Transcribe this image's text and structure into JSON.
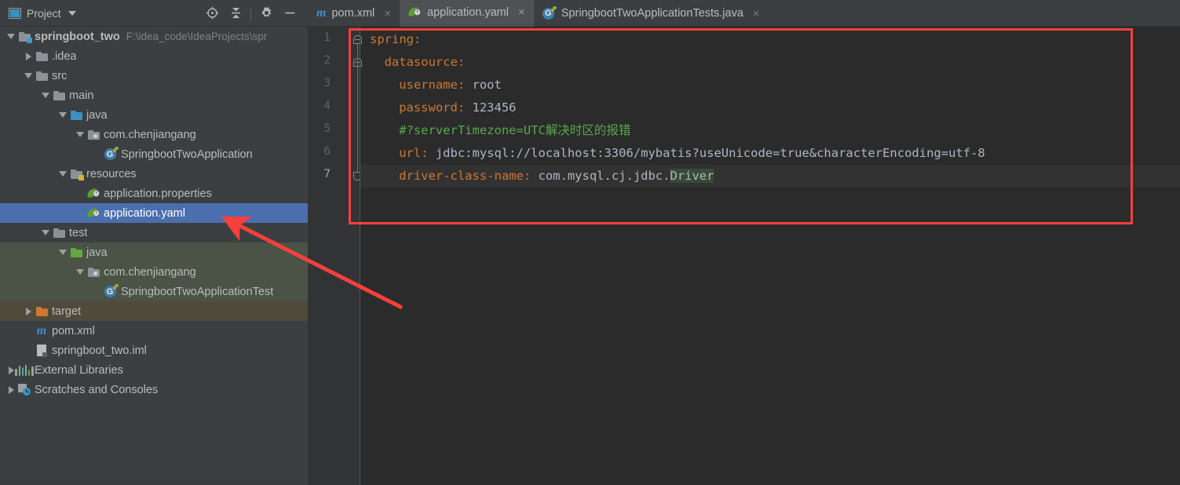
{
  "toolwindow": {
    "title": "Project",
    "icons": [
      {
        "name": "locate-target-icon",
        "glyph": "target"
      },
      {
        "name": "collapse-all-icon",
        "glyph": "collapse"
      },
      {
        "name": "settings-gear-icon",
        "glyph": "gear"
      },
      {
        "name": "hide-minimize-icon",
        "glyph": "minus"
      }
    ]
  },
  "tabs": [
    {
      "label": "pom.xml",
      "icon": "maven-icon",
      "active": false,
      "close": "×"
    },
    {
      "label": "application.yaml",
      "icon": "spring-leaf-icon",
      "active": true,
      "close": "×"
    },
    {
      "label": "SpringbootTwoApplicationTests.java",
      "icon": "spring-class-icon",
      "active": false,
      "close": "×"
    }
  ],
  "tree": [
    {
      "label": "springboot_two",
      "path": "F:\\idea_code\\IdeaProjects\\spr",
      "indent": 0,
      "twisty": "down",
      "icon": "module-folder",
      "bold": true,
      "state": "normal"
    },
    {
      "label": ".idea",
      "path": "",
      "indent": 1,
      "twisty": "right",
      "icon": "folder-gray",
      "bold": false,
      "state": "normal"
    },
    {
      "label": "src",
      "path": "",
      "indent": 1,
      "twisty": "down",
      "icon": "folder-gray",
      "bold": false,
      "state": "normal"
    },
    {
      "label": "main",
      "path": "",
      "indent": 2,
      "twisty": "down",
      "icon": "folder-gray",
      "bold": false,
      "state": "normal"
    },
    {
      "label": "java",
      "path": "",
      "indent": 3,
      "twisty": "down",
      "icon": "folder-blue",
      "bold": false,
      "state": "normal"
    },
    {
      "label": "com.chenjiangang",
      "path": "",
      "indent": 4,
      "twisty": "down",
      "icon": "package",
      "bold": false,
      "state": "normal"
    },
    {
      "label": "SpringbootTwoApplication",
      "path": "",
      "indent": 5,
      "twisty": "none",
      "icon": "spring-class-icon",
      "bold": false,
      "state": "normal"
    },
    {
      "label": "resources",
      "path": "",
      "indent": 3,
      "twisty": "down",
      "icon": "folder-resources",
      "bold": false,
      "state": "normal"
    },
    {
      "label": "application.properties",
      "path": "",
      "indent": 4,
      "twisty": "none",
      "icon": "spring-leaf-icon",
      "bold": false,
      "state": "normal"
    },
    {
      "label": "application.yaml",
      "path": "",
      "indent": 4,
      "twisty": "none",
      "icon": "spring-leaf-icon",
      "bold": false,
      "state": "selected"
    },
    {
      "label": "test",
      "path": "",
      "indent": 2,
      "twisty": "down",
      "icon": "folder-gray",
      "bold": false,
      "state": "normal"
    },
    {
      "label": "java",
      "path": "",
      "indent": 3,
      "twisty": "down",
      "icon": "folder-green",
      "bold": false,
      "state": "testroot"
    },
    {
      "label": "com.chenjiangang",
      "path": "",
      "indent": 4,
      "twisty": "down",
      "icon": "package",
      "bold": false,
      "state": "testroot"
    },
    {
      "label": "SpringbootTwoApplicationTest",
      "path": "",
      "indent": 5,
      "twisty": "none",
      "icon": "spring-class-icon",
      "bold": false,
      "state": "testroot"
    },
    {
      "label": "target",
      "path": "",
      "indent": 1,
      "twisty": "right",
      "icon": "folder-orange",
      "bold": false,
      "state": "excluded"
    },
    {
      "label": "pom.xml",
      "path": "",
      "indent": 1,
      "twisty": "none",
      "icon": "maven-icon",
      "bold": false,
      "state": "normal"
    },
    {
      "label": "springboot_two.iml",
      "path": "",
      "indent": 1,
      "twisty": "none",
      "icon": "iml-icon",
      "bold": false,
      "state": "normal"
    },
    {
      "label": "External Libraries",
      "path": "",
      "indent": 0,
      "twisty": "right",
      "icon": "libraries-icon",
      "bold": false,
      "state": "normal"
    },
    {
      "label": "Scratches and Consoles",
      "path": "",
      "indent": 0,
      "twisty": "right",
      "icon": "scratches-icon",
      "bold": false,
      "state": "normal"
    }
  ],
  "editor": {
    "file": "application.yaml",
    "line_numbers": [
      "1",
      "2",
      "3",
      "4",
      "5",
      "6",
      "7"
    ],
    "current_line": 7,
    "lines": [
      {
        "n": 1,
        "indent": 0,
        "segments": [
          {
            "t": "spring:",
            "c": "k"
          }
        ]
      },
      {
        "n": 2,
        "indent": 2,
        "segments": [
          {
            "t": "datasource:",
            "c": "k"
          }
        ]
      },
      {
        "n": 3,
        "indent": 4,
        "segments": [
          {
            "t": "username:",
            "c": "k"
          },
          {
            "t": " root",
            "c": "v"
          }
        ]
      },
      {
        "n": 4,
        "indent": 4,
        "segments": [
          {
            "t": "password:",
            "c": "k"
          },
          {
            "t": " 123456",
            "c": "v"
          }
        ]
      },
      {
        "n": 5,
        "indent": 4,
        "segments": [
          {
            "t": "#?serverTimezone=UTC解决时区的报错",
            "c": "cm"
          }
        ]
      },
      {
        "n": 6,
        "indent": 4,
        "segments": [
          {
            "t": "url:",
            "c": "k"
          },
          {
            "t": " jdbc:mysql://localhost:3306/mybatis?useUnicode=true&characterEncoding=utf-8",
            "c": "v"
          }
        ]
      },
      {
        "n": 7,
        "indent": 4,
        "segments": [
          {
            "t": "driver-class-name:",
            "c": "k"
          },
          {
            "t": " com.mysql.cj.jdbc.",
            "c": "v"
          },
          {
            "t": "Driver",
            "c": "v hl"
          }
        ]
      }
    ]
  },
  "annotations": {
    "highlight_box": {
      "name": "red-highlight-rectangle",
      "color": "#f5403d"
    },
    "arrow": {
      "name": "red-pointer-arrow",
      "color": "#f5403d",
      "points_to": "application.yaml"
    }
  },
  "colors": {
    "toolbar_bg": "#3c3f41",
    "editor_bg": "#2b2b2b",
    "gutter_bg": "#313335",
    "selection_blue": "#4b6eaf",
    "test_root_green": "#4b5346",
    "excluded_brown": "#4f4a3c",
    "keyword_orange": "#cc7832",
    "value_blue": "#a9b7c6",
    "comment_green": "#5aa84f",
    "annotation_red": "#f5403d"
  }
}
